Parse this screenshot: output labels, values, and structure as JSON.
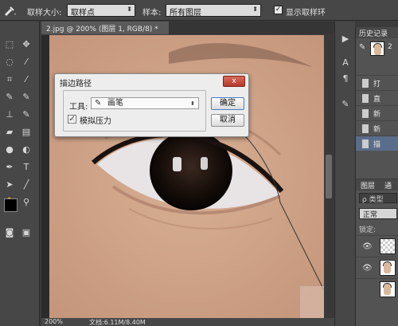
{
  "options_bar": {
    "sample_size_label": "取样大小:",
    "sample_size_value": "取样点",
    "sample_label": "样本:",
    "sample_value": "所有图层",
    "show_ring_label": "显示取样环",
    "show_ring_checked": true
  },
  "document": {
    "tab_title": "2.jpg @ 200% (图层 1, RGB/8) *",
    "zoom": "200%",
    "doc_info": "文档:6.11M/8.40M"
  },
  "dialog": {
    "title": "描边路径",
    "close_label": "x",
    "tool_label": "工具:",
    "tool_value": "画笔",
    "simulate_pressure_label": "模拟压力",
    "simulate_pressure_checked": true,
    "ok_label": "确定",
    "cancel_label": "取消"
  },
  "history_panel": {
    "header": "历史记录",
    "snapshot_label": "2",
    "items": [
      "打",
      "直",
      "新",
      "新",
      "描"
    ]
  },
  "layers_panel": {
    "tab_layers": "图层",
    "tab_channels": "通",
    "filter_label": "ρ 类型",
    "blend_mode": "正常",
    "lock_label": "锁定:"
  },
  "colors": {
    "foreground": "#000000",
    "background": "#ffffff",
    "ui_dark": "#3b3b3b",
    "panel": "#535353",
    "selection": "#5a6d8a"
  }
}
